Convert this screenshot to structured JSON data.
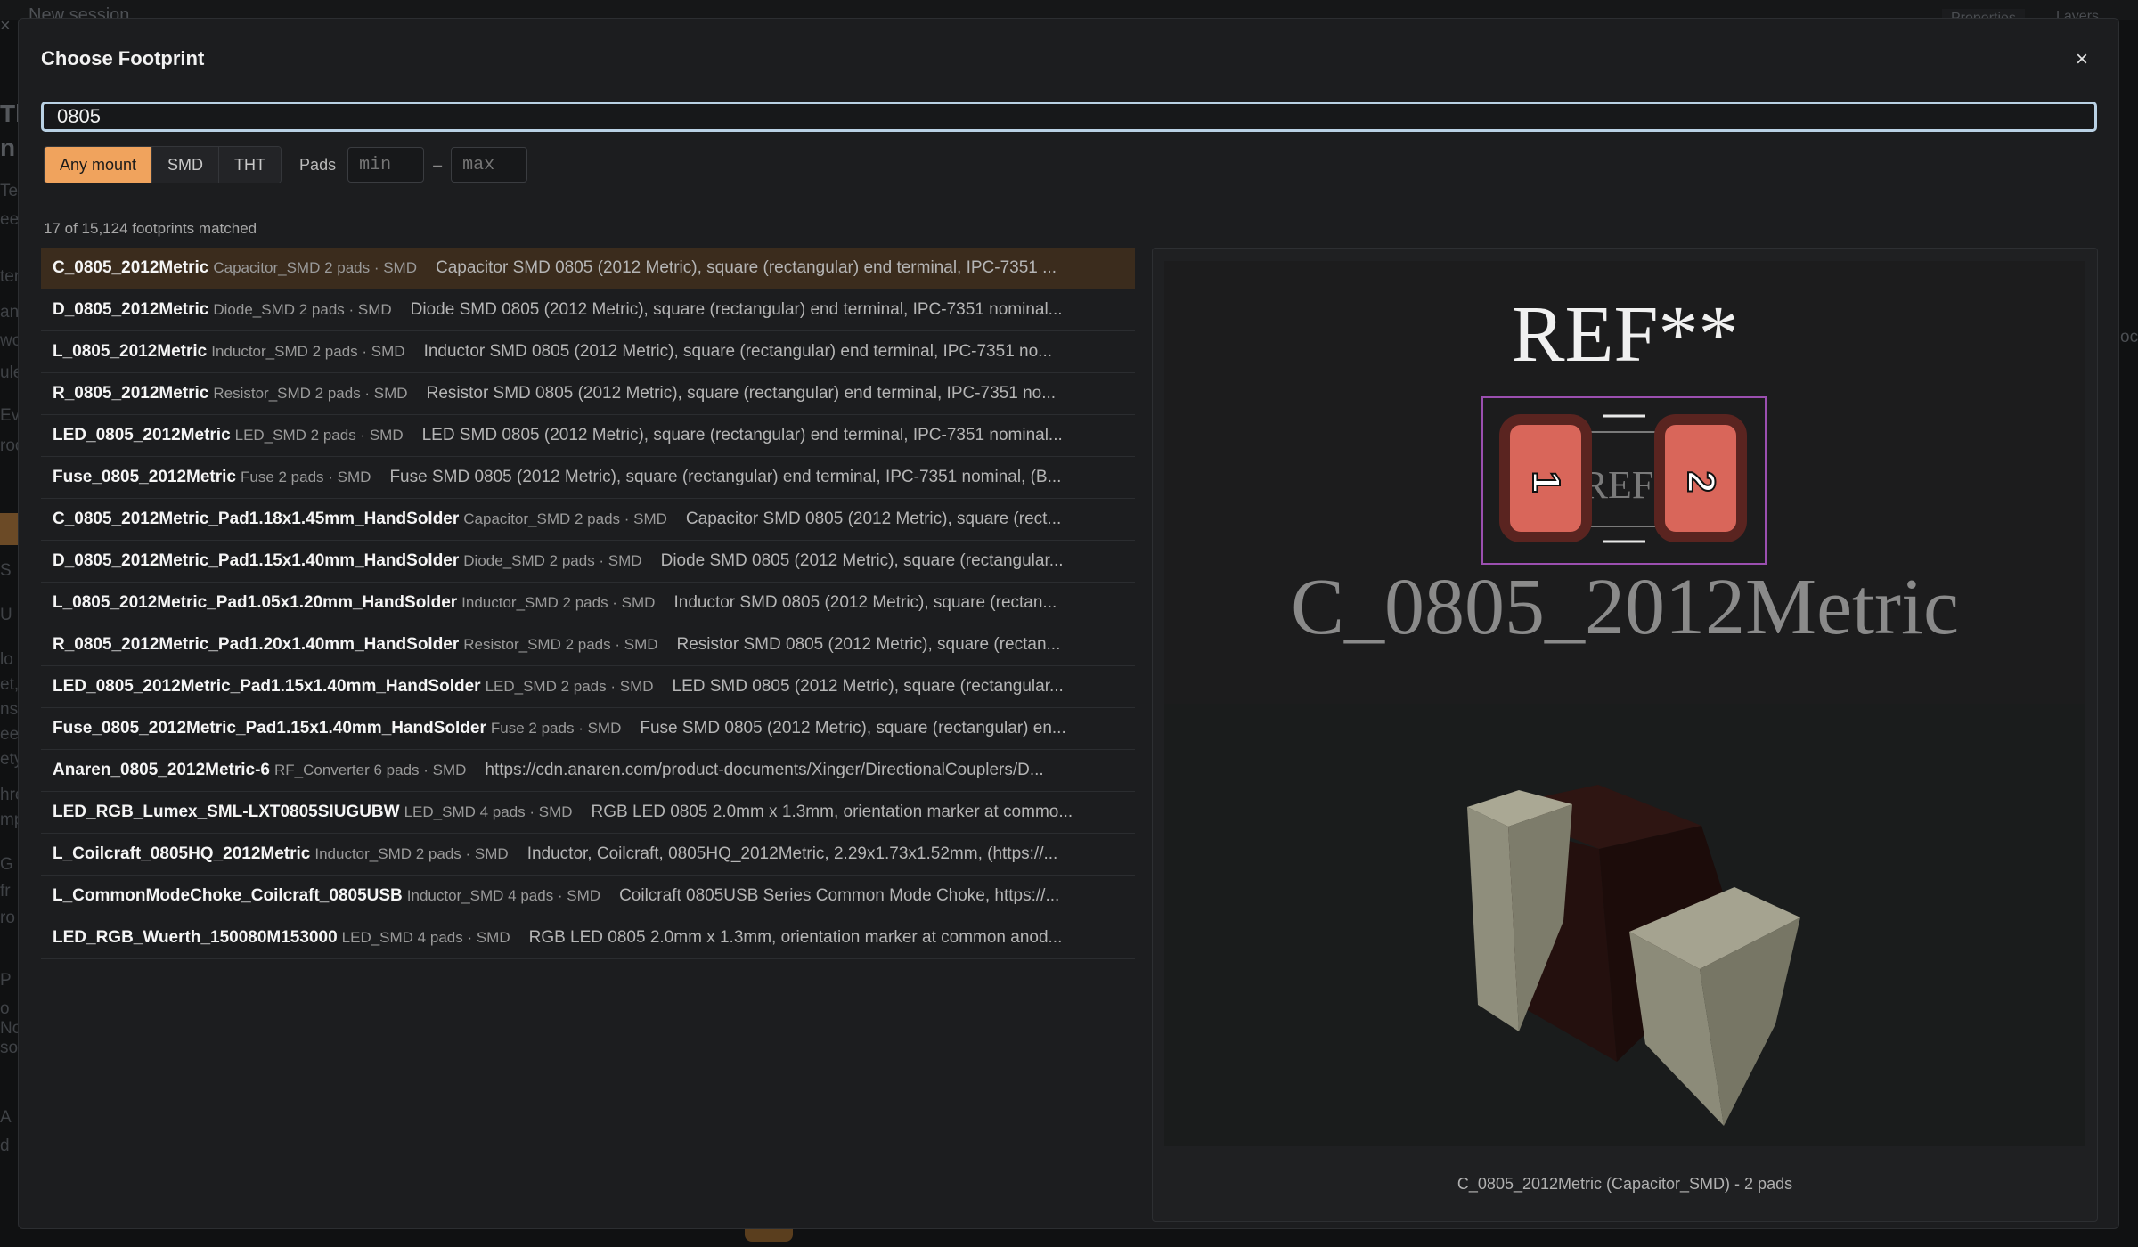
{
  "background": {
    "session_title": "New session",
    "tab_properties": "Properties",
    "tab_layers": "Layers"
  },
  "modal": {
    "title": "Choose Footprint",
    "close_label": "×"
  },
  "search": {
    "value": "0805"
  },
  "filters": {
    "mount_options": [
      "Any mount",
      "SMD",
      "THT"
    ],
    "selected_mount": "Any mount",
    "pads_label": "Pads",
    "pads_min_placeholder": "min",
    "pads_max_placeholder": "max",
    "pads_separator": "–"
  },
  "result_count": "17 of 15,124 footprints matched",
  "results": [
    {
      "name": "C_0805_2012Metric",
      "meta": "Capacitor_SMD 2 pads · SMD",
      "desc": "Capacitor SMD 0805 (2012 Metric), square (rectangular) end terminal, IPC-7351 ..."
    },
    {
      "name": "D_0805_2012Metric",
      "meta": "Diode_SMD 2 pads · SMD",
      "desc": "Diode SMD 0805 (2012 Metric), square (rectangular) end terminal, IPC-7351 nominal..."
    },
    {
      "name": "L_0805_2012Metric",
      "meta": "Inductor_SMD 2 pads · SMD",
      "desc": "Inductor SMD 0805 (2012 Metric), square (rectangular) end terminal, IPC-7351 no..."
    },
    {
      "name": "R_0805_2012Metric",
      "meta": "Resistor_SMD 2 pads · SMD",
      "desc": "Resistor SMD 0805 (2012 Metric), square (rectangular) end terminal, IPC-7351 no..."
    },
    {
      "name": "LED_0805_2012Metric",
      "meta": "LED_SMD 2 pads · SMD",
      "desc": "LED SMD 0805 (2012 Metric), square (rectangular) end terminal, IPC-7351 nominal..."
    },
    {
      "name": "Fuse_0805_2012Metric",
      "meta": "Fuse 2 pads · SMD",
      "desc": "Fuse SMD 0805 (2012 Metric), square (rectangular) end terminal, IPC-7351 nominal, (B..."
    },
    {
      "name": "C_0805_2012Metric_Pad1.18x1.45mm_HandSolder",
      "meta": "Capacitor_SMD 2 pads · SMD",
      "desc": "Capacitor SMD 0805 (2012 Metric), square (rect..."
    },
    {
      "name": "D_0805_2012Metric_Pad1.15x1.40mm_HandSolder",
      "meta": "Diode_SMD 2 pads · SMD",
      "desc": "Diode SMD 0805 (2012 Metric), square (rectangular..."
    },
    {
      "name": "L_0805_2012Metric_Pad1.05x1.20mm_HandSolder",
      "meta": "Inductor_SMD 2 pads · SMD",
      "desc": "Inductor SMD 0805 (2012 Metric), square (rectan..."
    },
    {
      "name": "R_0805_2012Metric_Pad1.20x1.40mm_HandSolder",
      "meta": "Resistor_SMD 2 pads · SMD",
      "desc": "Resistor SMD 0805 (2012 Metric), square (rectan..."
    },
    {
      "name": "LED_0805_2012Metric_Pad1.15x1.40mm_HandSolder",
      "meta": "LED_SMD 2 pads · SMD",
      "desc": "LED SMD 0805 (2012 Metric), square (rectangular..."
    },
    {
      "name": "Fuse_0805_2012Metric_Pad1.15x1.40mm_HandSolder",
      "meta": "Fuse 2 pads · SMD",
      "desc": "Fuse SMD 0805 (2012 Metric), square (rectangular) en..."
    },
    {
      "name": "Anaren_0805_2012Metric-6",
      "meta": "RF_Converter 6 pads · SMD",
      "desc": "https://cdn.anaren.com/product-documents/Xinger/DirectionalCouplers/D..."
    },
    {
      "name": "LED_RGB_Lumex_SML-LXT0805SIUGUBW",
      "meta": "LED_SMD 4 pads · SMD",
      "desc": "RGB LED 0805 2.0mm x 1.3mm, orientation marker at commo..."
    },
    {
      "name": "L_Coilcraft_0805HQ_2012Metric",
      "meta": "Inductor_SMD 2 pads · SMD",
      "desc": "Inductor, Coilcraft, 0805HQ_2012Metric, 2.29x1.73x1.52mm, (https://..."
    },
    {
      "name": "L_CommonModeChoke_Coilcraft_0805USB",
      "meta": "Inductor_SMD 4 pads · SMD",
      "desc": "Coilcraft 0805USB Series Common Mode Choke, https://..."
    },
    {
      "name": "LED_RGB_Wuerth_150080M153000",
      "meta": "LED_SMD 4 pads · SMD",
      "desc": "RGB LED 0805 2.0mm x 1.3mm, orientation marker at common anod..."
    }
  ],
  "selected_index": 0,
  "preview": {
    "ref_text": "REF**",
    "fab_ref_text": "REF*",
    "value_text": "C_0805_2012Metric",
    "pad_numbers": [
      "1",
      "2"
    ],
    "caption": "C_0805_2012Metric (Capacitor_SMD) - 2 pads",
    "colors": {
      "pad": "#d9665a",
      "courtyard": "#9b4fb0",
      "silkscreen": "#e8e8e8",
      "fab": "#7a7a7a",
      "body": "#2a1210",
      "terminal": "#8f8e7c"
    }
  },
  "theme": {
    "accent": "#f0a35d",
    "selected_row_bg": "#3b2c1d",
    "focus_border": "#b9d1e4"
  }
}
